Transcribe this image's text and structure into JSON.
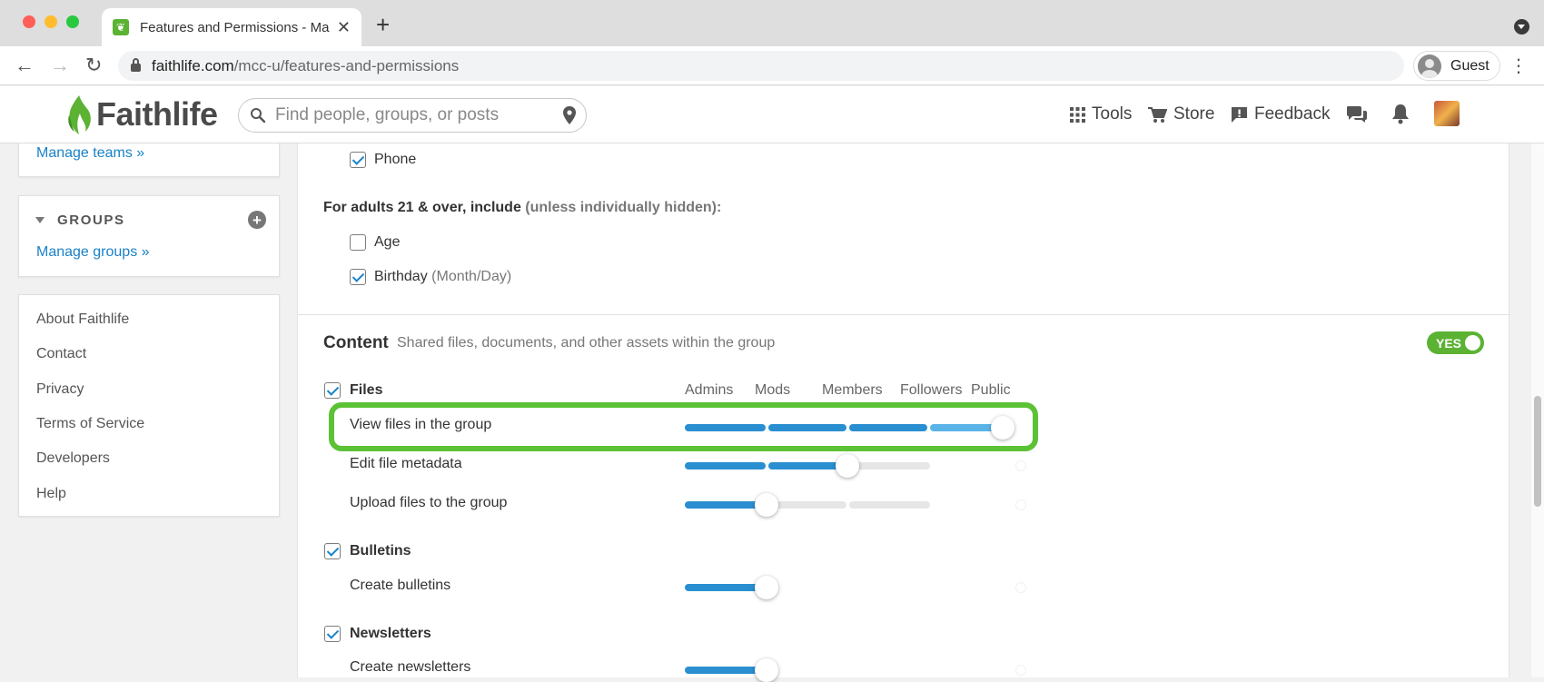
{
  "browser": {
    "tab_title": "Features and Permissions - Ma",
    "url_domain": "faithlife.com",
    "url_path": "/mcc-u/features-and-permissions",
    "profile_label": "Guest"
  },
  "header": {
    "logo_text": "Faithlife",
    "search_placeholder": "Find people, groups, or posts",
    "nav": [
      {
        "label": "Tools",
        "icon": "grid-icon"
      },
      {
        "label": "Store",
        "icon": "cart-icon"
      },
      {
        "label": "Feedback",
        "icon": "feedback-icon"
      }
    ]
  },
  "sidebar": {
    "manage_teams": "Manage teams »",
    "groups_title": "GROUPS",
    "manage_groups": "Manage groups »",
    "footer_links": [
      "About Faithlife",
      "Contact",
      "Privacy",
      "Terms of Service",
      "Developers",
      "Help"
    ]
  },
  "main": {
    "phone_label": "Phone",
    "adults_heading": "For adults 21 & over, include",
    "adults_note": "(unless individually hidden):",
    "age_label": "Age",
    "birthday_label": "Birthday",
    "birthday_note": "(Month/Day)",
    "content_title": "Content",
    "content_desc": "Shared files, documents, and other assets within the group",
    "content_toggle": "YES",
    "columns": [
      "Admins",
      "Mods",
      "Members",
      "Followers",
      "Public"
    ],
    "files": {
      "label": "Files",
      "permissions": [
        {
          "label": "View files in the group",
          "level": "Public"
        },
        {
          "label": "Edit file metadata",
          "level": "Members"
        },
        {
          "label": "Upload files to the group",
          "level": "Mods"
        }
      ]
    },
    "bulletins": {
      "label": "Bulletins",
      "permissions": [
        {
          "label": "Create bulletins",
          "level": "Mods"
        }
      ]
    },
    "newsletters": {
      "label": "Newsletters",
      "permissions": [
        {
          "label": "Create newsletters",
          "level": "Mods"
        }
      ]
    }
  },
  "colors": {
    "brand_green": "#5bb233",
    "link_blue": "#1a82c8",
    "slider_blue": "#2a8fd1",
    "highlight_green": "#5bc236"
  }
}
